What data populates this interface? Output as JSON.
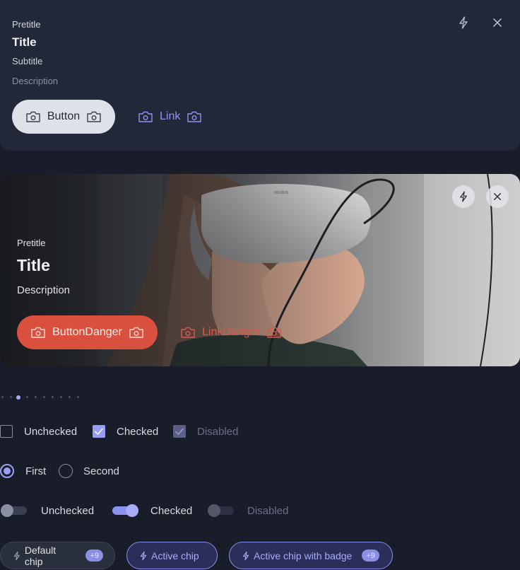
{
  "colors": {
    "background": "#191d2a",
    "card": "#222837",
    "accent": "#989cf7",
    "danger": "#d9503e"
  },
  "card1": {
    "pretitle": "Pretitle",
    "title": "Title",
    "subtitle": "Subtitle",
    "description": "Description",
    "button_label": "Button",
    "link_label": "Link",
    "icons": [
      "bolt-icon",
      "close-icon",
      "camera-icon"
    ]
  },
  "card2": {
    "pretitle": "Pretitle",
    "title": "Title",
    "description": "Description",
    "button_label": "ButtonDanger",
    "link_label": "LinkDanger",
    "image": "woman-wearing-vr-headset",
    "headset_brand": "oculus"
  },
  "pagination": {
    "count": 10,
    "active_index": 2
  },
  "checkboxes": [
    {
      "label": "Unchecked",
      "state": "unchecked"
    },
    {
      "label": "Checked",
      "state": "checked"
    },
    {
      "label": "Disabled",
      "state": "checked-disabled"
    }
  ],
  "radios": [
    {
      "label": "First",
      "selected": true
    },
    {
      "label": "Second",
      "selected": false
    }
  ],
  "toggles": [
    {
      "label": "Unchecked",
      "state": "off"
    },
    {
      "label": "Checked",
      "state": "on"
    },
    {
      "label": "Disabled",
      "state": "off-disabled"
    }
  ],
  "chips": [
    {
      "label": "Default chip",
      "badge": "+9",
      "variant": "default"
    },
    {
      "label": "Active chip",
      "variant": "active"
    },
    {
      "label": "Active chip with badge",
      "badge": "+9",
      "variant": "active"
    }
  ]
}
